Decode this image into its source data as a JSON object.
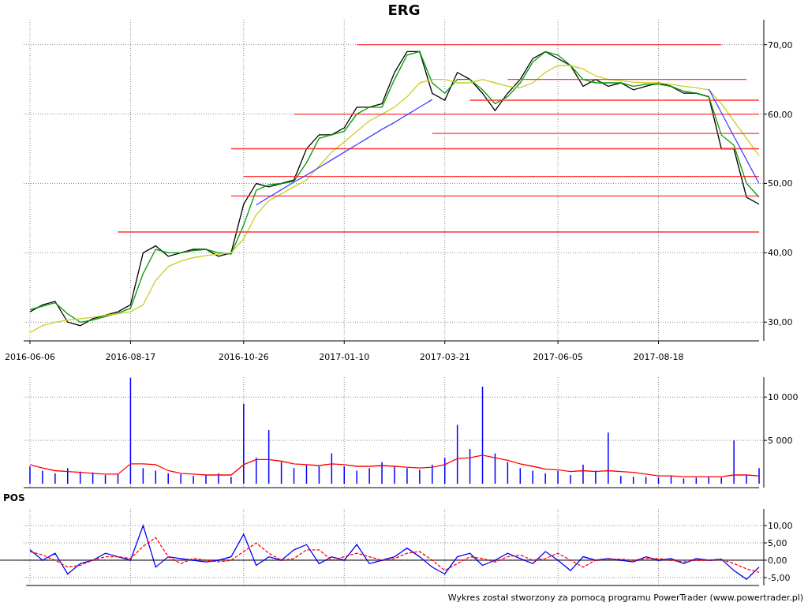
{
  "title": "ERG",
  "price_panel": {
    "chart_data": {
      "type": "line",
      "categories": [
        "2016-06-06",
        null,
        null,
        null,
        null,
        null,
        null,
        null,
        "2016-08-17",
        null,
        null,
        null,
        null,
        null,
        null,
        null,
        null,
        "2016-10-26",
        null,
        null,
        null,
        null,
        null,
        null,
        null,
        "2017-01-10",
        null,
        null,
        null,
        null,
        null,
        null,
        null,
        "2017-03-21",
        null,
        null,
        null,
        null,
        null,
        null,
        null,
        null,
        "2017-06-05",
        null,
        null,
        null,
        null,
        null,
        null,
        null,
        "2017-08-18",
        null,
        null,
        null,
        null,
        null,
        null,
        null,
        null
      ],
      "grid": true,
      "ylim": [
        27.3,
        73.6
      ],
      "yticks": [
        {
          "value": 30,
          "label": "30,00"
        },
        {
          "value": 40,
          "label": "40,00"
        },
        {
          "value": 50,
          "label": "50,00"
        },
        {
          "value": 60,
          "label": "60,00"
        },
        {
          "value": 70,
          "label": "70,00"
        }
      ],
      "series": [
        {
          "color": "#000000",
          "values": [
            31.5,
            32.5,
            33,
            30,
            29.5,
            30.5,
            31,
            31.5,
            32.5,
            40,
            41,
            39.5,
            40,
            40.5,
            40.5,
            39.5,
            40,
            47,
            50,
            49.5,
            50,
            50.5,
            55,
            57,
            57,
            58,
            61,
            61,
            61.5,
            66,
            69,
            69,
            63,
            62,
            66,
            65,
            63,
            60.5,
            63,
            65,
            68,
            69,
            68,
            67,
            64,
            65,
            64,
            64.5,
            63.5,
            64,
            64.5,
            64,
            63,
            63,
            62.5,
            55,
            55,
            48,
            47
          ]
        },
        {
          "color": "#009900",
          "values": [
            31.8,
            32.3,
            32.8,
            31.2,
            30,
            30.3,
            30.8,
            31.3,
            32,
            37,
            40.5,
            40,
            40,
            40.3,
            40.5,
            40,
            39.8,
            44,
            49,
            49.8,
            50,
            50.3,
            53,
            56.5,
            57,
            57.5,
            60,
            61,
            61,
            65,
            68.5,
            69,
            64.5,
            63,
            65,
            65,
            63.5,
            61.5,
            62.5,
            64.5,
            67.5,
            69,
            68.5,
            67,
            65,
            64.5,
            64.5,
            64.5,
            64,
            64.3,
            64.3,
            64,
            63.3,
            63,
            62.5,
            57,
            55.5,
            50,
            48
          ]
        },
        {
          "color": "#cccc22",
          "values": [
            28.5,
            29.5,
            30,
            30.3,
            30.5,
            30.7,
            31,
            31.2,
            31.5,
            32.5,
            36,
            38,
            38.8,
            39.3,
            39.6,
            39.8,
            40,
            42,
            45.5,
            47.5,
            48.5,
            49.5,
            50.5,
            52.5,
            54.5,
            56,
            57.5,
            59,
            60,
            61,
            62.5,
            64.5,
            65,
            65,
            64.5,
            64.5,
            65,
            64.5,
            64,
            63.8,
            64.5,
            66,
            67,
            67,
            66.5,
            65.5,
            65,
            64.8,
            64.6,
            64.5,
            64.5,
            64.3,
            64,
            63.8,
            63.5,
            61.5,
            59,
            56.5,
            54
          ]
        },
        {
          "color": "#ff3333",
          "values": [
            null,
            null,
            null,
            null,
            null,
            null,
            null,
            null,
            null,
            null,
            null,
            null,
            null,
            null,
            null,
            null,
            null,
            null,
            null,
            null,
            null,
            null,
            null,
            null,
            null,
            null,
            70,
            70,
            70,
            70,
            70,
            70,
            70,
            70,
            70,
            70,
            70,
            70,
            70,
            70,
            70,
            70,
            70,
            70,
            70,
            70,
            70,
            70,
            70,
            70,
            70,
            70,
            70,
            70,
            70,
            70,
            null,
            null,
            null
          ]
        },
        {
          "color": "#ff3333",
          "values": [
            null,
            null,
            null,
            null,
            null,
            null,
            null,
            null,
            null,
            null,
            null,
            null,
            null,
            null,
            null,
            null,
            null,
            null,
            null,
            null,
            null,
            null,
            null,
            null,
            null,
            null,
            null,
            null,
            null,
            null,
            null,
            null,
            null,
            null,
            null,
            null,
            null,
            null,
            65,
            65,
            65,
            65,
            65,
            65,
            65,
            65,
            65,
            65,
            65,
            65,
            65,
            65,
            65,
            65,
            65,
            65,
            65,
            65,
            null
          ]
        },
        {
          "color": "#ff3333",
          "values": [
            null,
            null,
            null,
            null,
            null,
            null,
            null,
            null,
            null,
            null,
            null,
            null,
            null,
            null,
            null,
            null,
            null,
            null,
            null,
            null,
            null,
            null,
            null,
            null,
            null,
            null,
            null,
            null,
            null,
            null,
            null,
            null,
            null,
            null,
            null,
            62,
            62,
            62,
            62,
            62,
            62,
            62,
            62,
            62,
            62,
            62,
            62,
            62,
            62,
            62,
            62,
            62,
            62,
            62,
            62,
            62,
            62,
            62,
            62
          ]
        },
        {
          "color": "#ff3333",
          "values": [
            null,
            null,
            null,
            null,
            null,
            null,
            null,
            null,
            null,
            null,
            null,
            null,
            null,
            null,
            null,
            null,
            null,
            null,
            null,
            null,
            null,
            60,
            60,
            60,
            60,
            60,
            60,
            60,
            60,
            60,
            60,
            60,
            60,
            60,
            60,
            60,
            60,
            60,
            60,
            60,
            60,
            60,
            60,
            60,
            60,
            60,
            60,
            60,
            60,
            60,
            60,
            60,
            60,
            60,
            60,
            60,
            60,
            60,
            60
          ]
        },
        {
          "color": "#ff3333",
          "values": [
            null,
            null,
            null,
            null,
            null,
            null,
            null,
            null,
            null,
            null,
            null,
            null,
            null,
            null,
            null,
            null,
            null,
            null,
            null,
            null,
            null,
            null,
            null,
            null,
            null,
            null,
            null,
            null,
            null,
            null,
            null,
            null,
            57.2,
            57.2,
            57.2,
            57.2,
            57.2,
            57.2,
            57.2,
            57.2,
            57.2,
            57.2,
            57.2,
            57.2,
            57.2,
            57.2,
            57.2,
            57.2,
            57.2,
            57.2,
            57.2,
            57.2,
            57.2,
            57.2,
            57.2,
            57.2,
            57.2,
            57.2,
            57.2
          ]
        },
        {
          "color": "#ff3333",
          "values": [
            null,
            null,
            null,
            null,
            null,
            null,
            null,
            null,
            null,
            null,
            null,
            null,
            null,
            null,
            null,
            null,
            55,
            55,
            55,
            55,
            55,
            55,
            55,
            55,
            55,
            55,
            55,
            55,
            55,
            55,
            55,
            55,
            55,
            55,
            55,
            55,
            55,
            55,
            55,
            55,
            55,
            55,
            55,
            55,
            55,
            55,
            55,
            55,
            55,
            55,
            55,
            55,
            55,
            55,
            55,
            55,
            55,
            55,
            55
          ]
        },
        {
          "color": "#ff3333",
          "values": [
            null,
            null,
            null,
            null,
            null,
            null,
            null,
            null,
            null,
            null,
            null,
            null,
            null,
            null,
            null,
            null,
            null,
            51,
            51,
            51,
            51,
            51,
            51,
            51,
            51,
            51,
            51,
            51,
            51,
            51,
            51,
            51,
            51,
            51,
            51,
            51,
            51,
            51,
            51,
            51,
            51,
            51,
            51,
            51,
            51,
            51,
            51,
            51,
            51,
            51,
            51,
            51,
            51,
            51,
            51,
            51,
            51,
            51,
            51
          ]
        },
        {
          "color": "#ff3333",
          "values": [
            null,
            null,
            null,
            null,
            null,
            null,
            null,
            null,
            null,
            null,
            null,
            null,
            null,
            null,
            null,
            null,
            48.2,
            48.2,
            48.2,
            48.2,
            48.2,
            48.2,
            48.2,
            48.2,
            48.2,
            48.2,
            48.2,
            48.2,
            48.2,
            48.2,
            48.2,
            48.2,
            48.2,
            48.2,
            48.2,
            48.2,
            48.2,
            48.2,
            48.2,
            48.2,
            48.2,
            48.2,
            48.2,
            48.2,
            48.2,
            48.2,
            48.2,
            48.2,
            48.2,
            48.2,
            48.2,
            48.2,
            48.2,
            48.2,
            48.2,
            48.2,
            48.2,
            48.2,
            48.2
          ]
        },
        {
          "color": "#ff3333",
          "values": [
            null,
            null,
            null,
            null,
            null,
            null,
            null,
            43,
            43,
            43,
            43,
            43,
            43,
            43,
            43,
            43,
            43,
            43,
            43,
            43,
            43,
            43,
            43,
            43,
            43,
            43,
            43,
            43,
            43,
            43,
            43,
            43,
            43,
            43,
            43,
            43,
            43,
            43,
            43,
            43,
            43,
            43,
            43,
            43,
            43,
            43,
            43,
            43,
            43,
            43,
            43,
            43,
            43,
            43,
            43,
            43,
            43,
            43,
            43
          ]
        },
        {
          "color": "#4444ff",
          "values": [
            null,
            null,
            null,
            null,
            null,
            null,
            null,
            null,
            null,
            null,
            null,
            null,
            null,
            null,
            null,
            null,
            null,
            null,
            46.9,
            48,
            49.1,
            50.2,
            51.2,
            52.3,
            53.4,
            54.5,
            55.6,
            56.7,
            57.8,
            58.8,
            59.9,
            61,
            62.1,
            null,
            null,
            null,
            null,
            null,
            null,
            null,
            null,
            null,
            null,
            null,
            null,
            null,
            null,
            null,
            null,
            null,
            null,
            null,
            null,
            null,
            null,
            null,
            null,
            null,
            null
          ]
        },
        {
          "color": "#4444ff",
          "values": [
            null,
            null,
            null,
            null,
            null,
            null,
            null,
            null,
            null,
            null,
            null,
            null,
            null,
            null,
            null,
            null,
            null,
            null,
            null,
            null,
            null,
            null,
            null,
            null,
            null,
            null,
            null,
            null,
            null,
            null,
            null,
            null,
            null,
            null,
            null,
            null,
            null,
            null,
            null,
            null,
            null,
            null,
            null,
            null,
            null,
            null,
            null,
            null,
            null,
            null,
            null,
            null,
            null,
            null,
            63.6,
            60.2,
            56.8,
            53.4,
            50
          ]
        }
      ]
    }
  },
  "volume_panel": {
    "chart_data": {
      "type": "bar",
      "grid": true,
      "ylim": [
        0,
        12300
      ],
      "yticks": [
        {
          "value": 5000,
          "label": "5 000"
        },
        {
          "value": 10000,
          "label": "10 000"
        }
      ],
      "series": [
        {
          "color": "#0000ff",
          "values": [
            2000,
            1500,
            1200,
            1800,
            1400,
            1300,
            1000,
            1100,
            12200,
            1800,
            1500,
            1200,
            1100,
            900,
            1000,
            1200,
            800,
            9200,
            3000,
            6200,
            2500,
            1800,
            2200,
            2000,
            3500,
            2000,
            1500,
            1800,
            2500,
            2000,
            1800,
            1600,
            2200,
            3000,
            6800,
            4000,
            11200,
            3500,
            2500,
            1800,
            1500,
            1200,
            1500,
            1000,
            2200,
            1500,
            5900,
            900,
            800,
            800,
            700,
            900,
            600,
            700,
            800,
            700,
            5000,
            1000,
            1800
          ]
        },
        {
          "color": "#ff0000",
          "type": "line",
          "values": [
            2200,
            1800,
            1500,
            1400,
            1300,
            1200,
            1100,
            1100,
            2300,
            2300,
            2200,
            1500,
            1200,
            1100,
            1000,
            1000,
            1000,
            2200,
            2800,
            2800,
            2600,
            2300,
            2200,
            2100,
            2300,
            2200,
            2000,
            2000,
            2100,
            2000,
            1900,
            1800,
            1900,
            2200,
            2900,
            3000,
            3300,
            3000,
            2700,
            2300,
            2000,
            1700,
            1600,
            1400,
            1500,
            1400,
            1500,
            1400,
            1300,
            1100,
            900,
            900,
            800,
            800,
            800,
            800,
            1000,
            1000,
            900
          ]
        }
      ]
    }
  },
  "pos_panel": {
    "title": "POS",
    "chart_data": {
      "type": "line",
      "grid": true,
      "ylim": [
        -7.3,
        14.8
      ],
      "yticks": [
        {
          "value": -5,
          "label": "-5,00"
        },
        {
          "value": 0,
          "label": "0,00"
        },
        {
          "value": 5,
          "label": "5,00"
        },
        {
          "value": 10,
          "label": "10,00"
        }
      ],
      "series": [
        {
          "color": "#0000ff",
          "values": [
            3,
            0,
            2,
            -4,
            -1,
            0,
            2,
            1,
            0,
            10,
            -2,
            1,
            0.5,
            0,
            -0.5,
            0,
            1,
            7.5,
            -1.5,
            1,
            0,
            3,
            4.5,
            -1,
            1,
            0,
            4.5,
            -1,
            0,
            1,
            3.5,
            1,
            -2,
            -4,
            1,
            2,
            -1.5,
            0,
            2,
            0.5,
            -1,
            2.5,
            0,
            -3,
            1,
            0,
            0.5,
            0,
            -0.5,
            1,
            0,
            0.5,
            -1,
            0.5,
            0,
            0.3,
            -3,
            -5.5,
            -2
          ]
        },
        {
          "color": "#ff0000",
          "line_style": "dashed",
          "values": [
            2.5,
            1.5,
            0,
            -2,
            -1.5,
            0,
            1,
            1,
            0.5,
            4,
            6.5,
            1,
            -1,
            0.5,
            0,
            -0.5,
            0,
            2.5,
            5,
            2,
            0,
            0.5,
            3,
            3,
            0,
            1,
            2,
            1,
            0,
            0.5,
            2,
            2.5,
            0,
            -3,
            -1,
            1,
            0.5,
            -0.5,
            1,
            1.5,
            0,
            0.5,
            2,
            0,
            -2,
            0,
            0.3,
            0.3,
            0,
            0.5,
            0.5,
            0,
            -0.5,
            0,
            0,
            0.2,
            -1,
            -2.5,
            -3.5
          ]
        }
      ]
    }
  },
  "footer": "Wykres został stworzony za pomocą programu PowerTrader (www.powertrader.pl)"
}
